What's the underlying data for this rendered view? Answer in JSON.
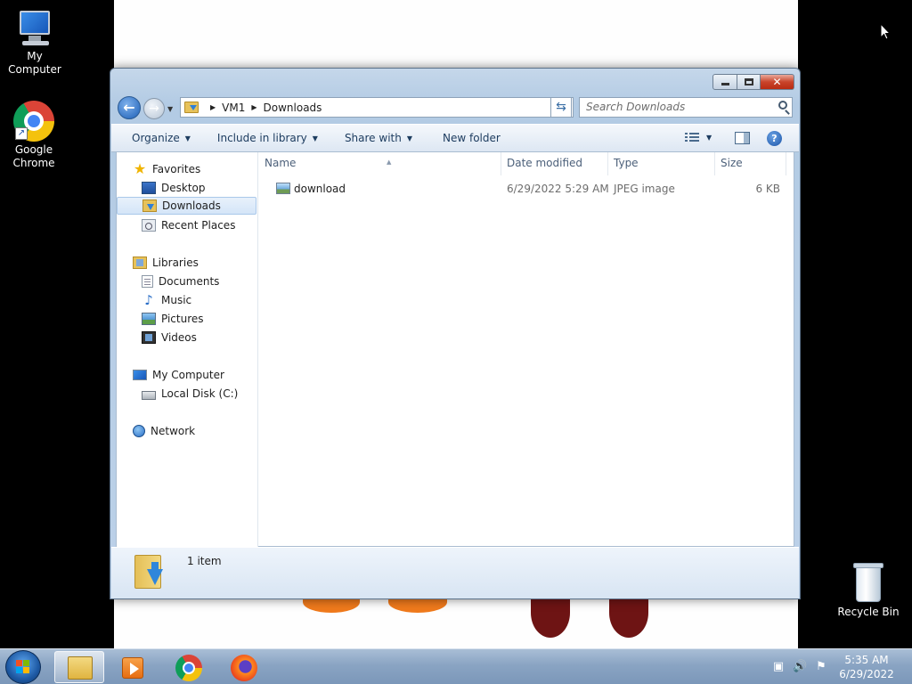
{
  "desktop": {
    "icons": [
      {
        "label": "My Computer",
        "icon": "computer-icon"
      },
      {
        "label": "Google Chrome",
        "icon": "chrome-icon"
      },
      {
        "label": "Recycle Bin",
        "icon": "recycle-bin-icon"
      }
    ]
  },
  "window": {
    "address": {
      "crumbs": [
        "VM1",
        "Downloads"
      ]
    },
    "search": {
      "placeholder": "Search Downloads"
    },
    "commands": {
      "organize": "Organize",
      "include_in_library": "Include in library",
      "share_with": "Share with",
      "new_folder": "New folder"
    },
    "nav": {
      "favorites": "Favorites",
      "desktop": "Desktop",
      "downloads": "Downloads",
      "recent_places": "Recent Places",
      "libraries": "Libraries",
      "documents": "Documents",
      "music": "Music",
      "pictures": "Pictures",
      "videos": "Videos",
      "my_computer": "My Computer",
      "local_disk": "Local Disk (C:)",
      "network": "Network",
      "selected": "Downloads"
    },
    "columns": {
      "name": "Name",
      "date_modified": "Date modified",
      "type": "Type",
      "size": "Size"
    },
    "files": [
      {
        "name": "download",
        "date_modified": "6/29/2022 5:29 AM",
        "type": "JPEG image",
        "size": "6 KB"
      }
    ],
    "status": {
      "item_count": "1 item"
    }
  },
  "taskbar": {
    "pinned": [
      "windows-explorer-icon",
      "media-player-icon",
      "chrome-icon",
      "firefox-icon"
    ],
    "active": "windows-explorer-icon",
    "clock": {
      "time": "5:35 AM",
      "date": "6/29/2022"
    }
  }
}
